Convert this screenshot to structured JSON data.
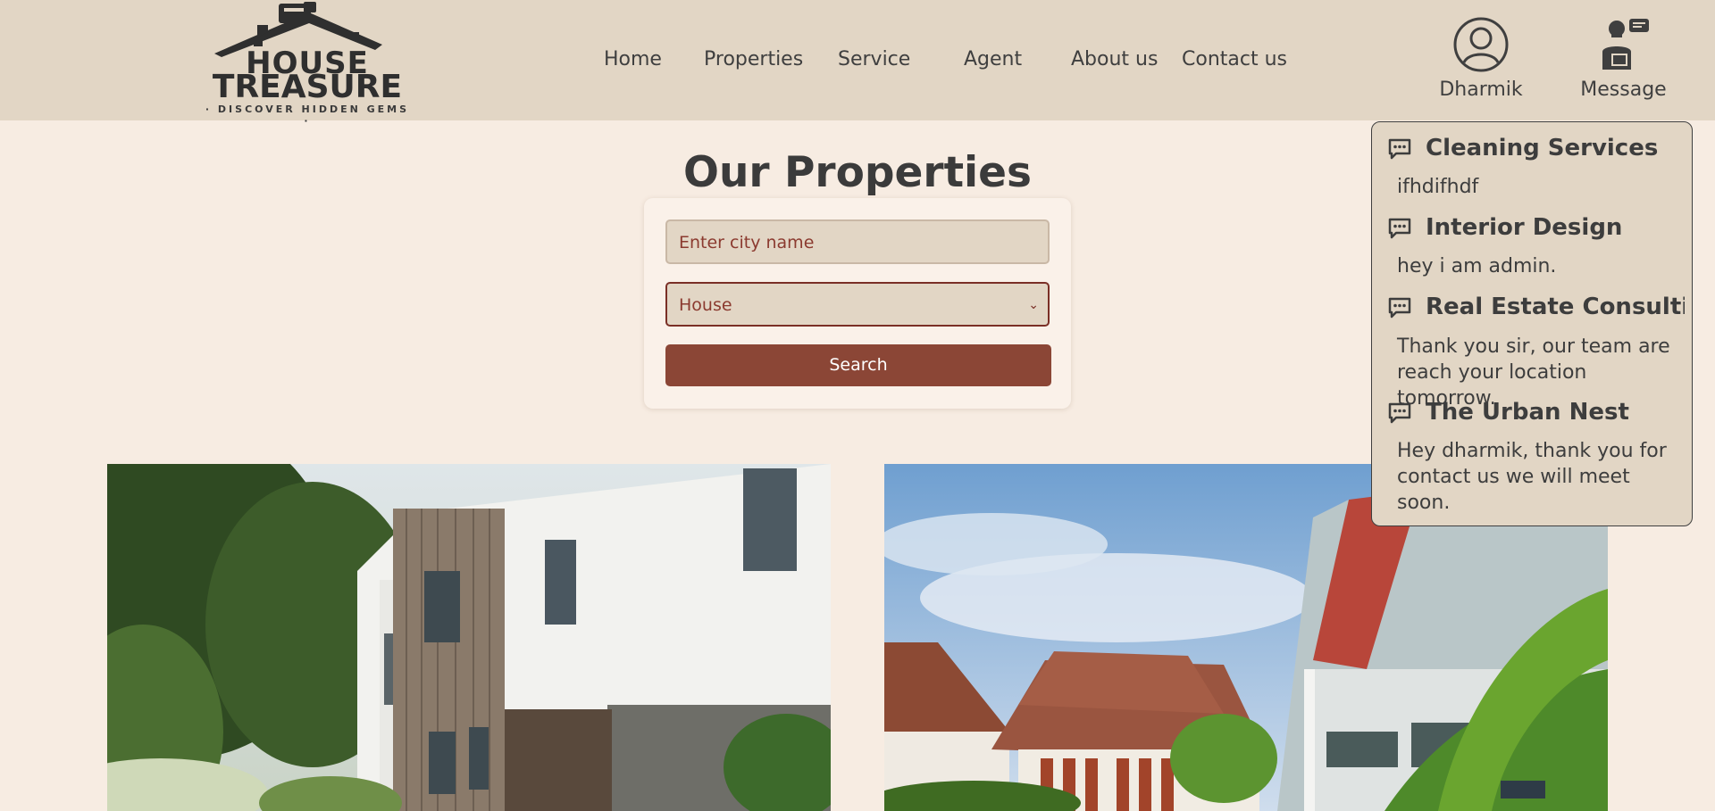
{
  "header": {
    "logo": {
      "brand_line1": "HOUSE",
      "brand_line2": "TREASURE",
      "tagline": "· DISCOVER HIDDEN GEMS ·",
      "icon": "house-roof-logo-icon"
    },
    "nav": [
      "Home",
      "Properties",
      "Service",
      "Agent",
      "About us",
      "Contact us"
    ],
    "user": {
      "label": "Dharmik",
      "icon": "user-circle-icon"
    },
    "messages": {
      "label": "Message",
      "icon": "agent-chat-icon"
    }
  },
  "main": {
    "title": "Our Properties",
    "search": {
      "city_placeholder": "Enter city name",
      "city_value": "",
      "type_selected": "House",
      "button_label": "Search"
    },
    "property_images": [
      "modern-house-photo",
      "tropical-villa-photo"
    ]
  },
  "message_dropdown": {
    "items": [
      {
        "title": "Cleaning Services",
        "body": "ifhdifhdf"
      },
      {
        "title": "Interior Design",
        "body": "hey i am admin."
      },
      {
        "title": "Real Estate Consulti",
        "body": "Thank you sir, our team are reach your location tomorrow."
      },
      {
        "title": "The Urban Nest",
        "body": "Hey dharmik, thank you for contact us we will meet soon."
      }
    ],
    "item_icon": "chat-bubble-icon"
  },
  "colors": {
    "page_bg": "#f7ece2",
    "header_bg": "#e2d6c5",
    "accent": "#8b4636",
    "input_text": "#8b3a2f",
    "dropdown_bg": "#e2d6c5"
  }
}
